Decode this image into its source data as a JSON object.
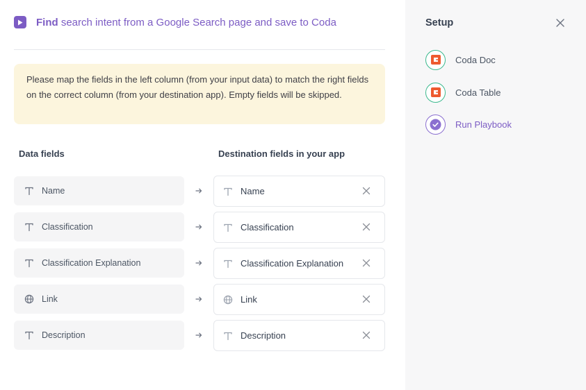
{
  "header": {
    "title_bold": "Find",
    "title_rest": "search intent from a Google Search page and save to Coda",
    "accent": "#7c5cc4"
  },
  "notice": {
    "text": "Please map the fields in the left column (from your input data) to match the right fields on the correct column (from your destination app). Empty fields will be skipped."
  },
  "columns": {
    "left": "Data fields",
    "right": "Destination fields in your app"
  },
  "mappings": [
    {
      "icon": "text-type-icon",
      "source": "Name",
      "destination": "Name"
    },
    {
      "icon": "text-type-icon",
      "source": "Classification",
      "destination": "Classification"
    },
    {
      "icon": "text-type-icon",
      "source": "Classification Explanation",
      "destination": "Classification Explanation"
    },
    {
      "icon": "globe-icon",
      "source": "Link",
      "destination": "Link"
    },
    {
      "icon": "text-type-icon",
      "source": "Description",
      "destination": "Description"
    }
  ],
  "sidebar": {
    "title": "Setup",
    "steps": [
      {
        "label": "Coda Doc",
        "icon": "coda-logo-icon",
        "status": "complete"
      },
      {
        "label": "Coda Table",
        "icon": "coda-logo-icon",
        "status": "complete"
      },
      {
        "label": "Run Playbook",
        "icon": "check-circle-icon",
        "status": "active"
      }
    ]
  },
  "colors": {
    "notice_bg": "#fcf5dd",
    "complete_ring": "#3cb98e",
    "active_ring": "#8b6fd0",
    "coda_brand": "#ee5a2f"
  }
}
